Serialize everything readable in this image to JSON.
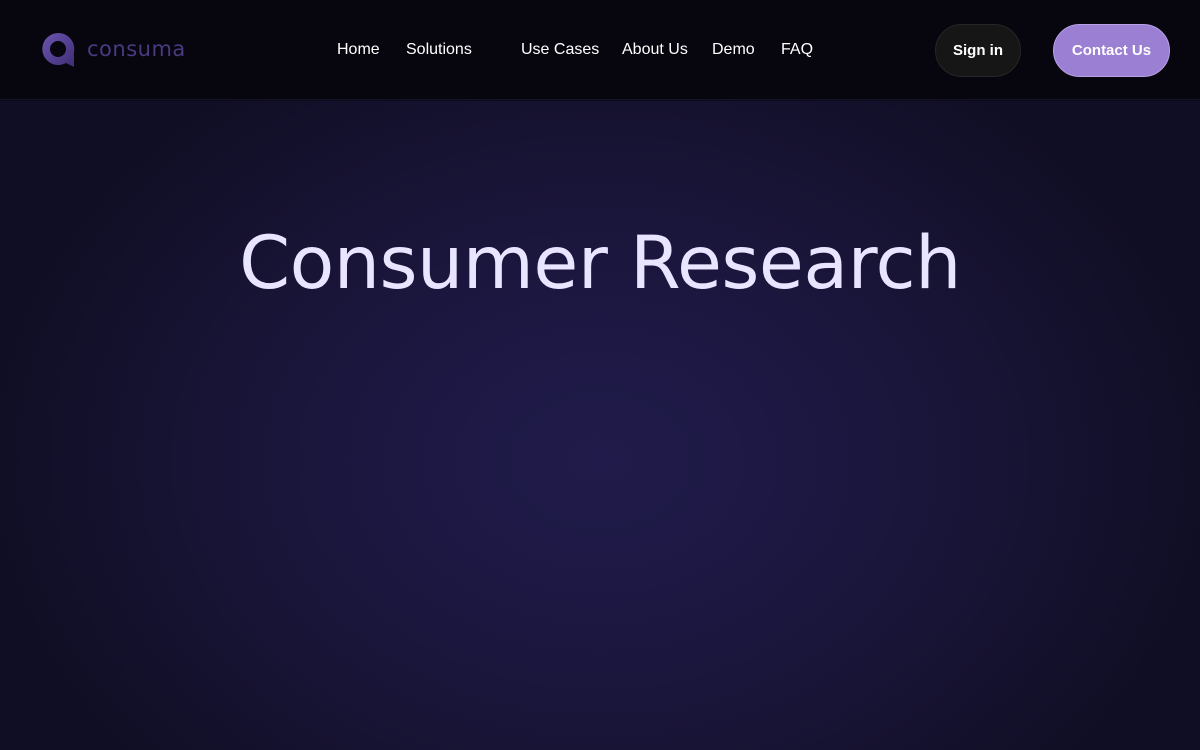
{
  "brand": {
    "name": "consuma",
    "color": "#4a3a80",
    "mark_icon": "consuma-logo-icon"
  },
  "nav": {
    "items": [
      {
        "label": "Home"
      },
      {
        "label": "Solutions"
      },
      {
        "label": "Use Cases"
      },
      {
        "label": "About Us"
      },
      {
        "label": "Demo"
      },
      {
        "label": "FAQ"
      }
    ]
  },
  "actions": {
    "signin_label": "Sign in",
    "contact_label": "Contact Us",
    "contact_color": "#9a7fd3"
  },
  "hero": {
    "title": "Consumer Research",
    "title_color": "#e9e4ff"
  }
}
